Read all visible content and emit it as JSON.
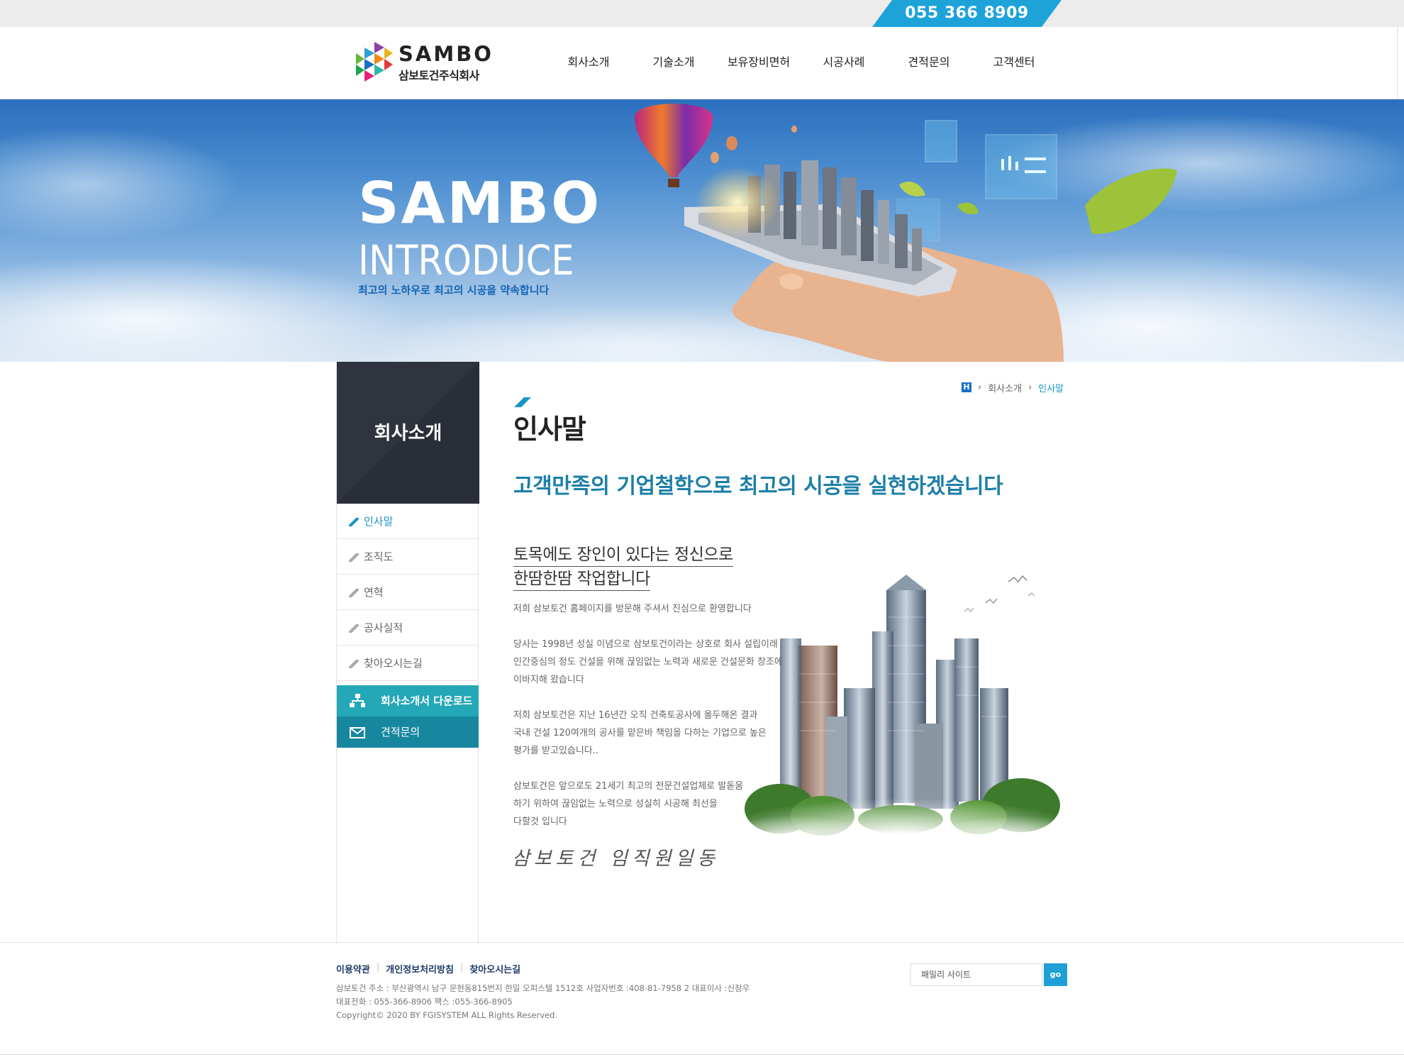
{
  "topbar": {
    "phone": "055 366 8909"
  },
  "header": {
    "logo_en": "SAMBO",
    "logo_ko": "삼보토건주식회사",
    "nav": [
      "회사소개",
      "기술소개",
      "보유장비면허",
      "시공사례",
      "견적문의",
      "고객센터"
    ]
  },
  "hero": {
    "title": "SAMBO",
    "subtitle": "INTRODUCE",
    "tagline": "최고의 노하우로 최고의 시공을 약속합니다"
  },
  "sidebar": {
    "heading": "회사소개",
    "items": [
      {
        "label": "인사말",
        "active": true
      },
      {
        "label": "조직도",
        "active": false
      },
      {
        "label": "연혁",
        "active": false
      },
      {
        "label": "공사실적",
        "active": false
      },
      {
        "label": "찾아오시는길",
        "active": false
      }
    ],
    "download_label": "회사소개서 다운로드",
    "estimate_label": "견적문의"
  },
  "breadcrumb": {
    "home": "H",
    "parent": "회사소개",
    "current": "인사말"
  },
  "content": {
    "title": "인사말",
    "lead": "고객만족의 기업철학으로 최고의 시공을 실현하겠습니다",
    "heading_line1": "토목에도 장인이 있다는 정신으로",
    "heading_line2": "한땀한땀 작업합니다",
    "p1": "저희 삼보토건 홈페이지를 방문해 주셔서 진심으로 환영합니다",
    "p2_l1": "당사는 1998년 성실 이념으로 삼보토건이라는 상호로 회사 설립이래",
    "p2_l2": "인간중심의 정도 건설을 위해 끊임없는 노력과 새로운 건설문화 창조에",
    "p2_l3": "이바지해 왔습니다",
    "p3_l1": "저희 삼보토건은 지난 16년간 오직 건축토공사에 올두해온 결과",
    "p3_l2": "국내 건설 120여개의 공사를 맡은바 책임을 다하는 기업으로 높은",
    "p3_l3": "평가를  받고있습니다..",
    "p4_l1": "삼보토건은 앞으로도 21세기 최고의 전문건설업체로 발돋움",
    "p4_l2": "하기 위하여 끊임없는 노력으로 성실히 시공해 최선을",
    "p4_l3": "다할것 입니다",
    "signature": "삼보토건 임직원일동"
  },
  "footer": {
    "links": [
      "이용약관",
      "개인정보처리방침",
      "찾아오시는길"
    ],
    "info_line1": "삼보토건    주소 : 부산광역시 남구 문현동815번지 한일 오피스텔 1512호    사업자번호 :408-81-7958 2   대표이사 :신창우",
    "info_line2": "대표전화 : 055-366-8906        팩스 :055-366-8905",
    "copyright": "Copyright© 2020 BY FGISYSTEM ALL Rights Reserved.",
    "family_site": "패밀리 사이트",
    "go": "go"
  },
  "colors": {
    "accent": "#1a95c4",
    "phone_tab": "#1ea3d9",
    "sidebar_dark": "#30343f",
    "download_btn": "#24a7b6",
    "estimate_btn": "#1787a0"
  },
  "icons": [
    "home-icon",
    "chevron-right-icon",
    "sitemap-icon",
    "mail-icon",
    "slash-icon"
  ]
}
